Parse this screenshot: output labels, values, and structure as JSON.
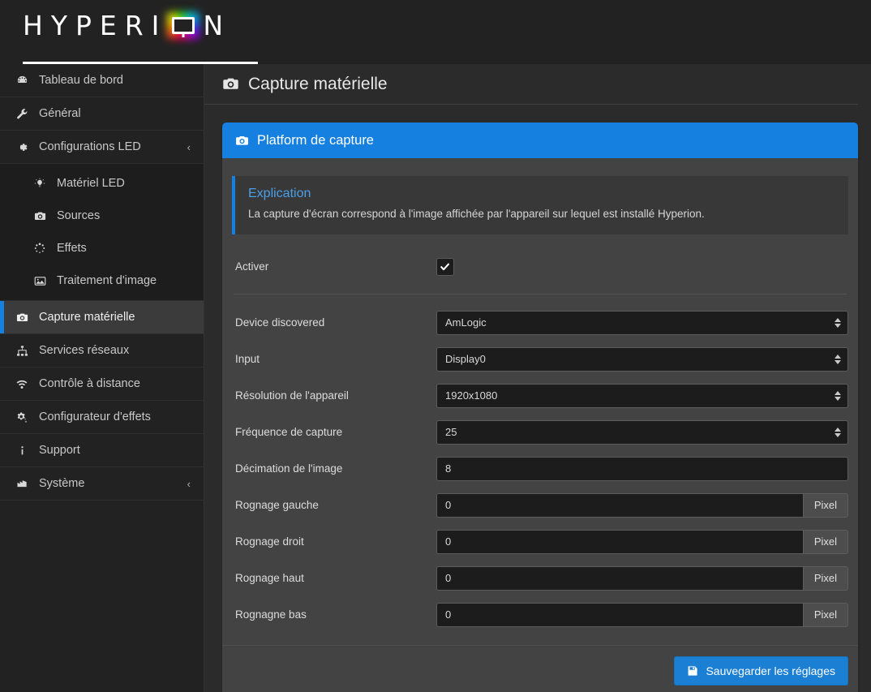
{
  "brand": {
    "name_part1": "HYPERI",
    "name_part2": "N",
    "tv_icon": "tv-monitor-icon"
  },
  "sidebar": {
    "items": [
      {
        "label": "Tableau de bord",
        "icon": "dashboard-icon",
        "type": "item",
        "active": false
      },
      {
        "label": "Général",
        "icon": "wrench-icon",
        "type": "item",
        "active": false
      },
      {
        "label": "Configurations LED",
        "icon": "gear-icon",
        "type": "group",
        "chevron": "‹",
        "active": false
      },
      {
        "label": "Matériel LED",
        "icon": "lightbulb-icon",
        "type": "sub",
        "active": false
      },
      {
        "label": "Sources",
        "icon": "camera-icon",
        "type": "sub",
        "active": false
      },
      {
        "label": "Effets",
        "icon": "spinner-icon",
        "type": "sub",
        "active": false
      },
      {
        "label": "Traitement d'image",
        "icon": "picture-icon",
        "type": "sub",
        "active": false
      },
      {
        "label": "Capture matérielle",
        "icon": "camera-icon",
        "type": "item",
        "active": true
      },
      {
        "label": "Services réseaux",
        "icon": "sitemap-icon",
        "type": "item",
        "active": false
      },
      {
        "label": "Contrôle à distance",
        "icon": "wifi-icon",
        "type": "item",
        "active": false
      },
      {
        "label": "Configurateur d'effets",
        "icon": "cogs-icon",
        "type": "item",
        "active": false
      },
      {
        "label": "Support",
        "icon": "info-icon",
        "type": "item",
        "active": false
      },
      {
        "label": "Système",
        "icon": "chart-bar-icon",
        "type": "group",
        "chevron": "‹",
        "active": false
      }
    ]
  },
  "page": {
    "title": "Capture matérielle",
    "title_icon": "camera-icon"
  },
  "panel": {
    "header_title": "Platform de capture",
    "header_icon": "camera-icon",
    "info": {
      "title": "Explication",
      "text": "La capture d'écran correspond à l'image affichée par l'appareil sur lequel est installé Hyperion."
    },
    "enable": {
      "label": "Activer",
      "checked": true,
      "icon": "check-icon"
    },
    "fields": [
      {
        "label": "Device discovered",
        "kind": "select",
        "value": "AmLogic"
      },
      {
        "label": "Input",
        "kind": "select",
        "value": "Display0"
      },
      {
        "label": "Résolution de l'appareil",
        "kind": "select",
        "value": "1920x1080"
      },
      {
        "label": "Fréquence de capture",
        "kind": "select",
        "value": "25"
      },
      {
        "label": "Décimation de l'image",
        "kind": "text",
        "value": "8"
      },
      {
        "label": "Rognage gauche",
        "kind": "text-addon",
        "value": "0",
        "addon": "Pixel"
      },
      {
        "label": "Rognage droit",
        "kind": "text-addon",
        "value": "0",
        "addon": "Pixel"
      },
      {
        "label": "Rognage haut",
        "kind": "text-addon",
        "value": "0",
        "addon": "Pixel"
      },
      {
        "label": "Rognagne bas",
        "kind": "text-addon",
        "value": "0",
        "addon": "Pixel"
      }
    ],
    "save_button": {
      "label": "Sauvegarder les réglages",
      "icon": "save-icon"
    }
  },
  "colors": {
    "accent_blue": "#1580e0",
    "button_blue": "#1b7fd4",
    "info_title": "#4a9fe8",
    "sidebar_bg": "#222222",
    "page_bg": "#2b2b2b",
    "panel_bg": "#434343"
  }
}
